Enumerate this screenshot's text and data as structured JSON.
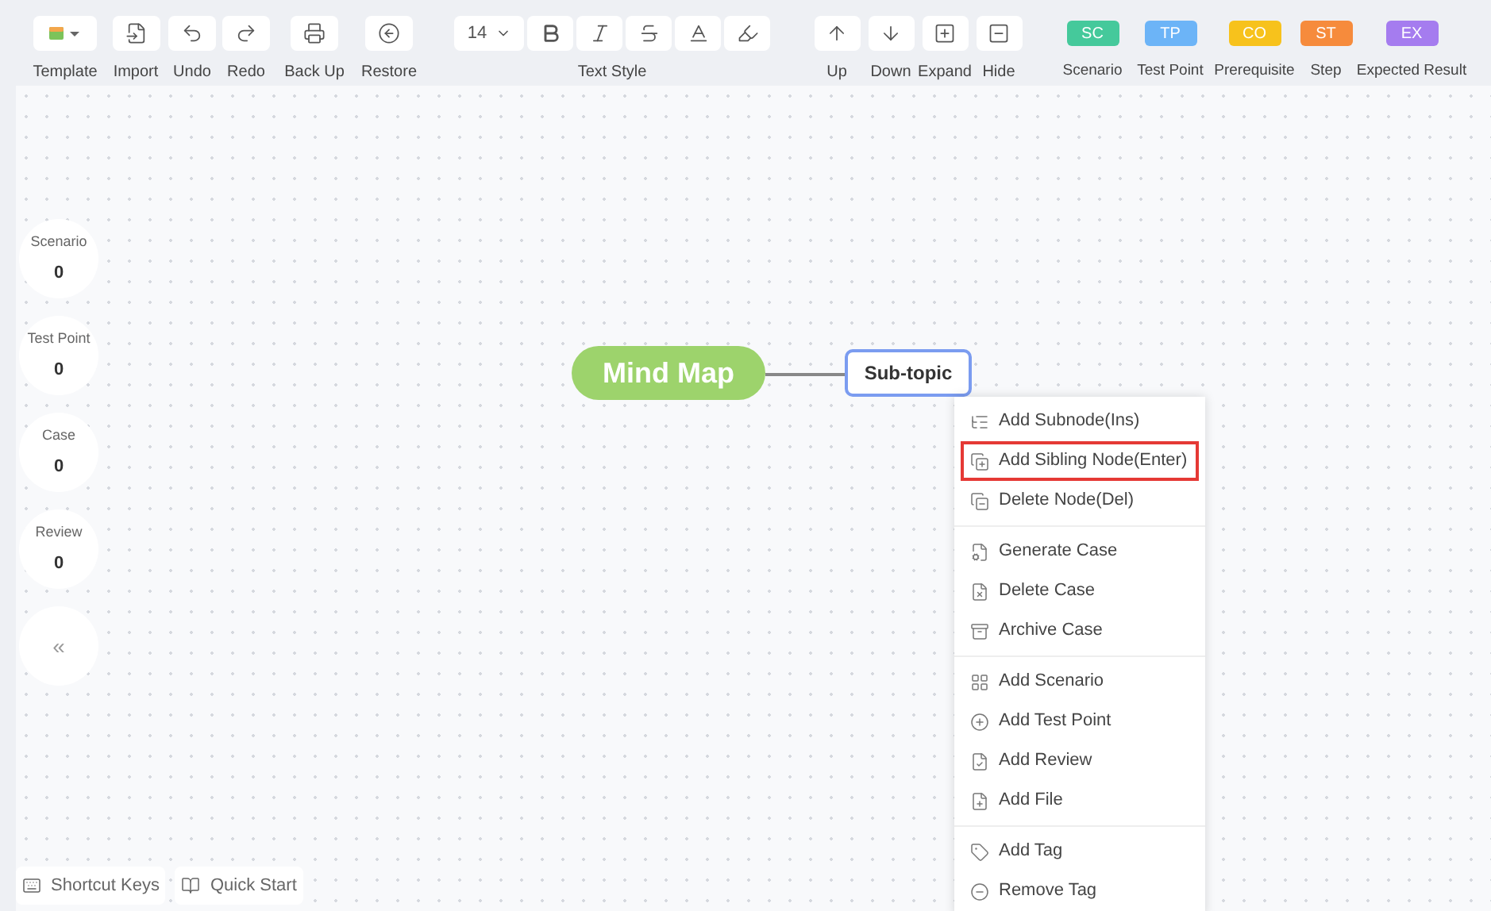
{
  "toolbar": {
    "file_tools": [
      {
        "label": "Template"
      },
      {
        "label": "Import"
      },
      {
        "label": "Undo"
      },
      {
        "label": "Redo"
      },
      {
        "label": "Back Up"
      },
      {
        "label": "Restore"
      }
    ],
    "text_style": {
      "font_size": "14",
      "label": "Text Style"
    },
    "node_tools": [
      {
        "label": "Up"
      },
      {
        "label": "Down"
      },
      {
        "label": "Expand"
      },
      {
        "label": "Hide"
      }
    ],
    "tags": [
      {
        "code": "SC",
        "label": "Scenario",
        "color": "#45c99b"
      },
      {
        "code": "TP",
        "label": "Test Point",
        "color": "#6cb4f7"
      },
      {
        "code": "CO",
        "label": "Prerequisite",
        "color": "#f7c21c"
      },
      {
        "code": "ST",
        "label": "Step",
        "color": "#f68b3c"
      },
      {
        "code": "EX",
        "label": "Expected Result",
        "color": "#a57cef"
      }
    ]
  },
  "stats": [
    {
      "label": "Scenario",
      "value": "0"
    },
    {
      "label": "Test Point",
      "value": "0"
    },
    {
      "label": "Case",
      "value": "0"
    },
    {
      "label": "Review",
      "value": "0"
    }
  ],
  "collapse_button": "«",
  "mind_map": {
    "root": "Mind Map",
    "child": "Sub-topic"
  },
  "context_menu": [
    [
      {
        "label": "Add Subnode(Ins)",
        "selected": false
      },
      {
        "label": "Add Sibling Node(Enter)",
        "selected": true
      },
      {
        "label": "Delete Node(Del)",
        "selected": false
      }
    ],
    [
      {
        "label": "Generate Case",
        "selected": false
      },
      {
        "label": "Delete Case",
        "selected": false
      },
      {
        "label": "Archive Case",
        "selected": false
      }
    ],
    [
      {
        "label": "Add Scenario",
        "selected": false
      },
      {
        "label": "Add Test Point",
        "selected": false
      },
      {
        "label": "Add Review",
        "selected": false
      },
      {
        "label": "Add File",
        "selected": false
      }
    ],
    [
      {
        "label": "Add Tag",
        "selected": false
      },
      {
        "label": "Remove Tag",
        "selected": false
      }
    ]
  ],
  "footer": [
    {
      "label": "Shortcut Keys"
    },
    {
      "label": "Quick Start"
    }
  ]
}
